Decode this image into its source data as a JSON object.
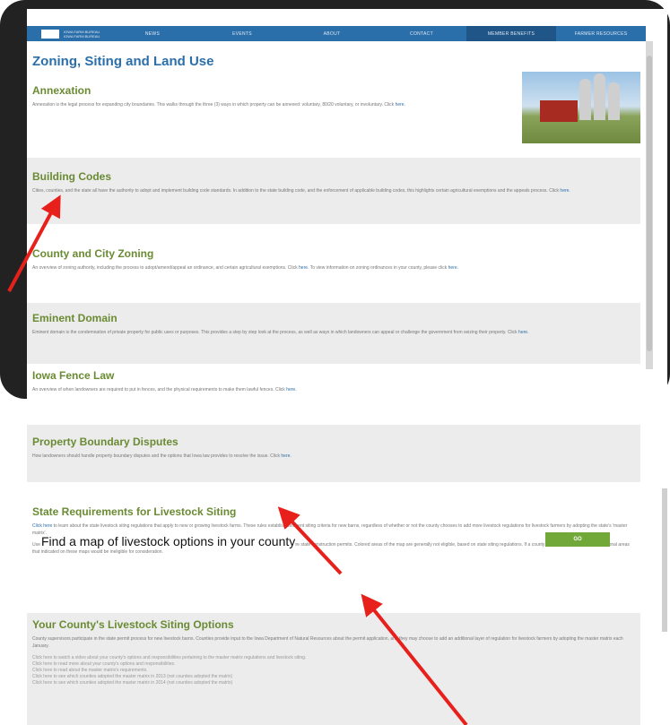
{
  "nav": {
    "brand_line1": "IOWA FARM BUREAU",
    "brand_line2": "IOWA FARM BUREAU",
    "items": [
      "NEWS",
      "EVENTS",
      "ABOUT",
      "CONTACT",
      "MEMBER BENEFITS",
      "FARMER RESOURCES"
    ]
  },
  "page": {
    "title": "Zoning, Siting and Land Use"
  },
  "sections": {
    "annexation": {
      "title": "Annexation",
      "body": "Annexation is the legal process for expanding city boundaries. This walks through the three (3) ways in which property can be annexed: voluntary, 80/20 voluntary, or involuntary. Click",
      "link": "here."
    },
    "building_codes": {
      "title": "Building Codes",
      "body": "Cities, counties, and the state all have the authority to adopt and implement building code standards. In addition to the state building code, and the enforcement of applicable building codes, this highlights certain agricultural exemptions and the appeals process. Click",
      "link": "here."
    },
    "county_zoning": {
      "title": "County and City Zoning",
      "body": "An overview of zoning authority, including the process to adopt/amend/appeal an ordinance, and certain agricultural exemptions. Click",
      "link": "here.",
      "body2": "To view information on zoning ordinances in your county, please click",
      "link2": "here."
    },
    "eminent_domain": {
      "title": "Eminent Domain",
      "body": "Eminent domain is the condemnation of private property for public uses or purposes. This provides a step by step look at the process, as well as ways in which landowners can appeal or challenge the government from seizing their property. Click",
      "link": "here."
    },
    "fence_law": {
      "title": "Iowa Fence Law",
      "body": "An overview of when landowners are required to put in fences, and the physical requirements to make them lawful fences. Click",
      "link": "here."
    },
    "boundary": {
      "title": "Property Boundary Disputes",
      "body": "How landowners should handle property boundary disputes and the options that Iowa law provides to resolve the issue. Click",
      "link": "here."
    },
    "livestock_siting": {
      "title": "State Requirements for Livestock Siting",
      "link": "Click here",
      "body": "to learn about the state livestock siting regulations that apply to new or growing livestock farms. These rules establish stringent siting criteria for new barns, regardless of whether or not the county chooses to add more livestock regulations for livestock farmers by adopting the state's 'master matrix'.",
      "body2": "Use the drop down menu, below to see which areas in your county are eligible for new livestock barns and manure storage that require state construction permits. Colored areas of the map are generally not eligible, based on state siting regulations. If a county adopts the master matrix, additional areas that indicated on these maps would be ineligible for consideration."
    },
    "county_options": {
      "title": "Your County's Livestock Siting Options",
      "body": "County supervisors participate in the state permit process for new livestock barns. Counties provide input to the Iowa Department of Natural Resources about the permit application, and they may choose to add an additional layer of regulation for livestock farmers by adopting the master matrix each January.",
      "links": [
        "Click here to watch a video about your county's options and responsibilities pertaining to the master matrix regulations and livestock siting.",
        "Click here to read more about your county's options and responsibilities.",
        "Click here to read about the master matrix's requirements.",
        "Click here to see which counties adopted the master matrix in 2013 (not counties adopted the matrix)",
        "Click here to see which counties adopted the master matrix in 2014 (not counties adopted the matrix)"
      ]
    }
  },
  "go_button": "GO",
  "callout": "Find a map of livestock options in your county",
  "colors": {
    "nav": "#2b6faa",
    "heading": "#2b6faa",
    "section_title": "#6a8b33",
    "button": "#72a83a",
    "arrow": "#e8201c"
  }
}
